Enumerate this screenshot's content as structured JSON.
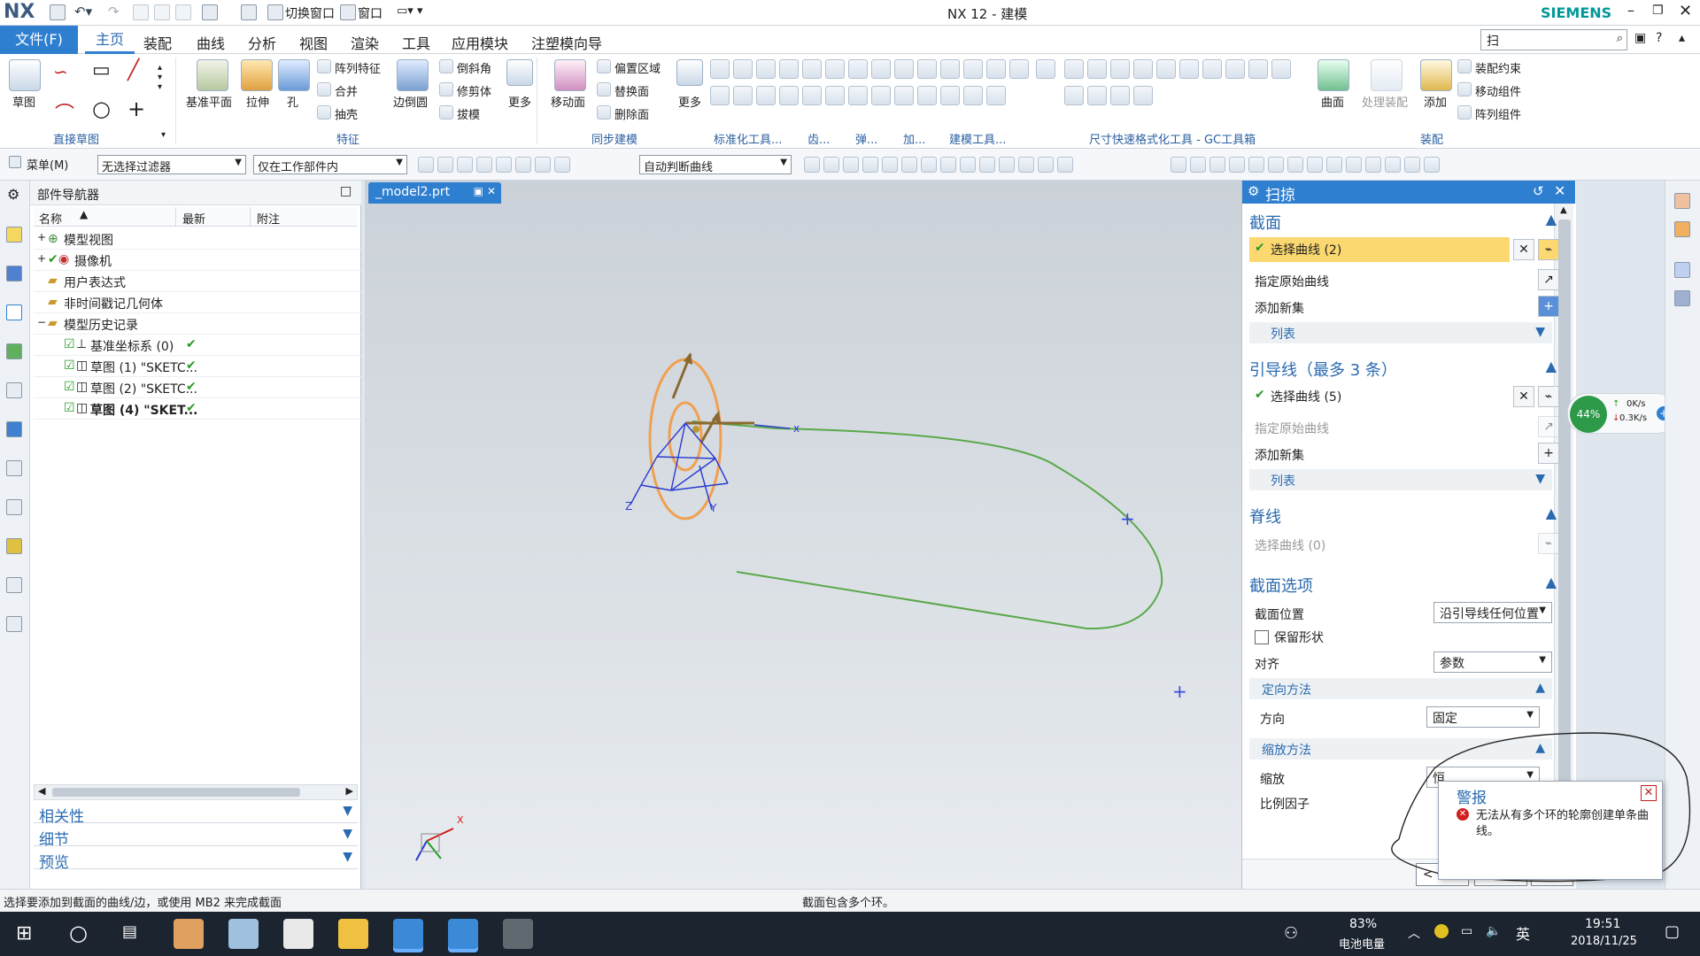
{
  "app": {
    "logo": "NX",
    "title": "NX 12 - 建模",
    "brand": "SIEMENS",
    "switch_window": "切换窗口",
    "window": "窗口"
  },
  "menu": {
    "file": "文件(F)",
    "tabs": [
      "主页",
      "装配",
      "曲线",
      "分析",
      "视图",
      "渲染",
      "工具",
      "应用模块",
      "注塑模向导"
    ],
    "search_value": "扫"
  },
  "ribbon": {
    "sketch": "草图",
    "datum_plane": "基准平面",
    "extrude": "拉伸",
    "hole": "孔",
    "edge_blend": "边倒圆",
    "more": "更多",
    "pattern_feature": "阵列特征",
    "unite": "合并",
    "shell": "抽壳",
    "chamfer": "倒斜角",
    "trim_body": "修剪体",
    "draft": "拔模",
    "move_face": "移动面",
    "offset_region": "偏置区域",
    "replace_face": "替换面",
    "delete_face": "删除面",
    "more2": "更多",
    "surface": "曲面",
    "process_assembly": "处理装配",
    "add": "添加",
    "assembly_constraint": "装配约束",
    "move_component": "移动组件",
    "pattern_component": "阵列组件",
    "groups": {
      "direct_sketch": "直接草图",
      "feature": "特征",
      "sync_modeling": "同步建模",
      "std_tools": "标准化工具...",
      "gear": "齿...",
      "spring": "弹...",
      "machining": "加...",
      "modeling_tools": "建模工具...",
      "gc": "尺寸快速格式化工具 - GC工具箱",
      "assembly": "装配"
    }
  },
  "toolbar2": {
    "menu": "菜单(M)",
    "filter": "无选择过滤器",
    "scope": "仅在工作部件内",
    "curve_rule": "自动判断曲线"
  },
  "nav": {
    "title": "部件导航器",
    "columns": [
      "名称",
      "最新",
      "附注"
    ],
    "rows": [
      {
        "label": "模型视图",
        "check": ""
      },
      {
        "label": "摄像机",
        "check": ""
      },
      {
        "label": "用户表达式",
        "check": ""
      },
      {
        "label": "非时间戳记几何体",
        "check": ""
      },
      {
        "label": "模型历史记录",
        "check": ""
      },
      {
        "label": "基准坐标系 (0)",
        "check": "✔"
      },
      {
        "label": "草图 (1) \"SKETC...",
        "check": "✔"
      },
      {
        "label": "草图 (2) \"SKETC...",
        "check": "✔"
      },
      {
        "label": "草图 (4) \"SKET...",
        "check": "✔"
      }
    ],
    "panels": [
      "相关性",
      "细节",
      "预览"
    ]
  },
  "viewport": {
    "tab": "_model2.prt",
    "axis_x": "x",
    "axis_y": "Y",
    "axis_z": "Z"
  },
  "dialog": {
    "title": "扫掠",
    "section": "截面",
    "select_curve": "选择曲线 (2)",
    "specify_origin": "指定原始曲线",
    "add_set": "添加新集",
    "list": "列表",
    "guide": "引导线（最多 3 条）",
    "select_curve_guide": "选择曲线 (5)",
    "specify_origin_guide": "指定原始曲线",
    "add_set_guide": "添加新集",
    "list_guide": "列表",
    "spine": "脊线",
    "select_curve_spine": "选择曲线 (0)",
    "section_options": "截面选项",
    "section_location": "截面位置",
    "section_location_value": "沿引导线任何位置",
    "preserve_shape": "保留形状",
    "alignment": "对齐",
    "alignment_value": "参数",
    "orientation_method": "定向方法",
    "direction": "方向",
    "direction_value": "固定",
    "scaling_method": "缩放方法",
    "scaling": "缩放",
    "scale_factor": "比例因子",
    "scale_value": "恒",
    "ok": "< 确定 >",
    "apply": "应用",
    "cancel": "取消"
  },
  "alert": {
    "title": "警报",
    "message": "无法从有多个环的轮廓创建单条曲线。"
  },
  "net_widget": {
    "percent": "44%",
    "up": "0K/s",
    "down": "0.3K/s"
  },
  "status": {
    "left": "选择要添加到截面的曲线/边，或使用 MB2 来完成截面",
    "center": "截面包含多个环。"
  },
  "taskbar": {
    "battery": "83%",
    "battery_label": "电池电量",
    "lang": "英",
    "time": "19:51",
    "date": "2018/11/25"
  }
}
